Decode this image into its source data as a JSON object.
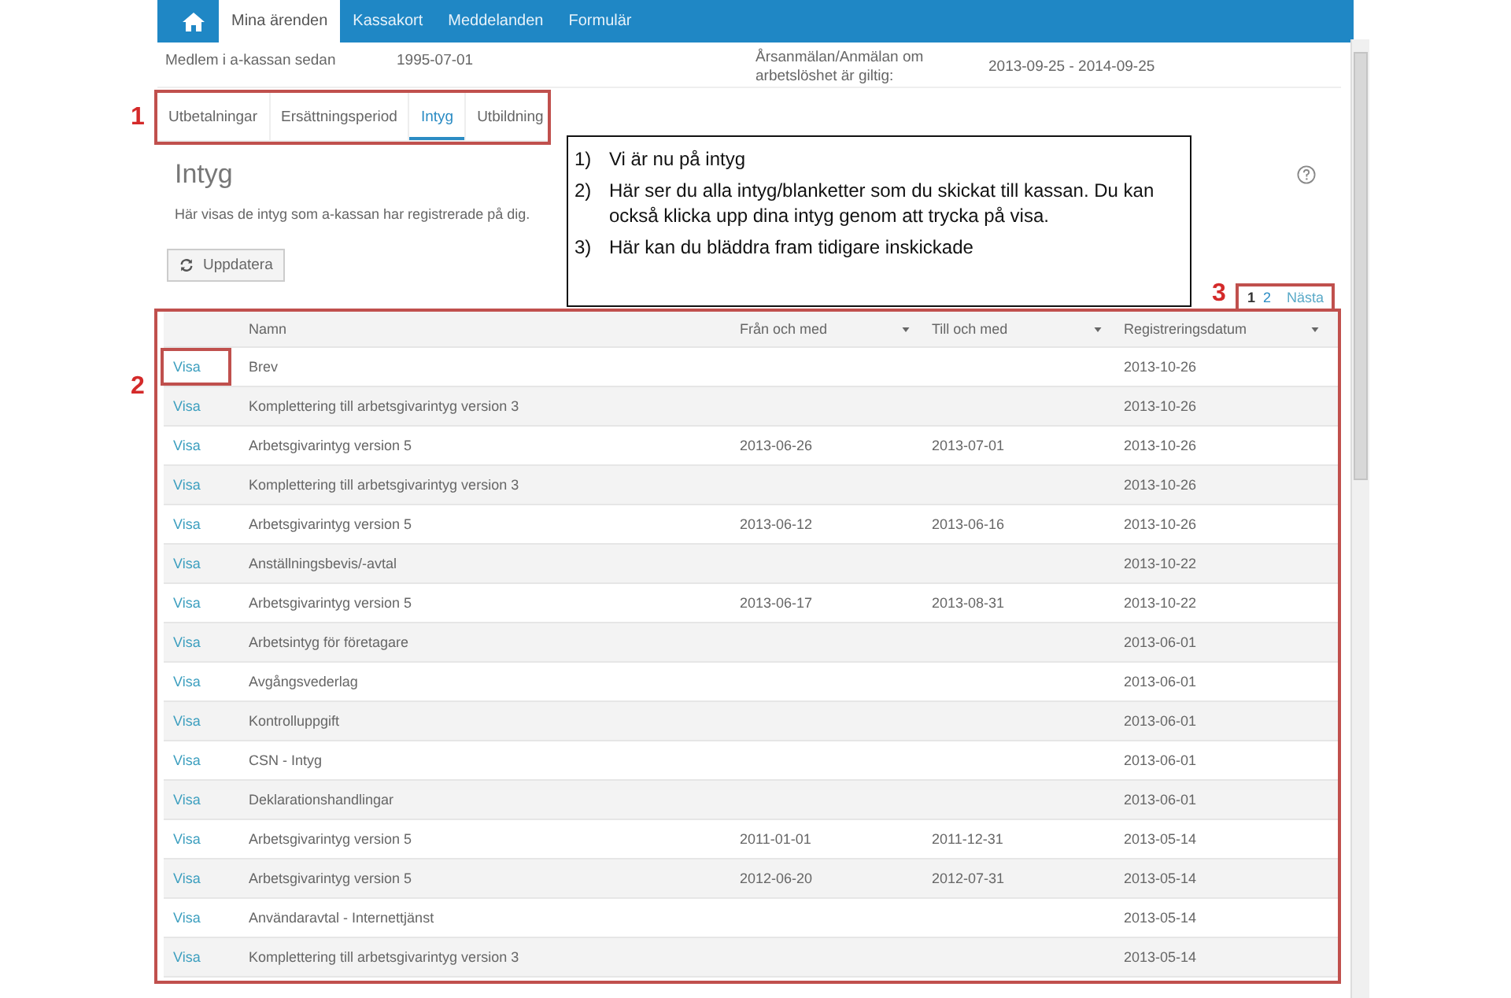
{
  "nav": {
    "items": [
      {
        "label": "Mina ärenden",
        "selected": true
      },
      {
        "label": "Kassakort",
        "selected": false
      },
      {
        "label": "Meddelanden",
        "selected": false
      },
      {
        "label": "Formulär",
        "selected": false
      }
    ]
  },
  "info": [
    {
      "label": "Medlem i a-kassan sedan",
      "value": "1995-07-01"
    },
    {
      "label": "Årsanmälan/Anmälan om arbetslöshet är giltig:",
      "value": "2013-09-25 - 2014-09-25"
    }
  ],
  "subtabs": {
    "highlighted": true,
    "items": [
      {
        "label": "Utbetalningar",
        "selected": false
      },
      {
        "label": "Ersättningsperiod",
        "selected": false
      },
      {
        "label": "Intyg",
        "selected": true
      },
      {
        "label": "Utbildning",
        "selected": false
      }
    ]
  },
  "heading": "Intyg",
  "description": "Här visas de intyg som a-kassan har registrerade på dig.",
  "refresh_button": "Uppdatera",
  "pagination": {
    "highlighted": true,
    "pages": [
      {
        "label": "1",
        "selected": true
      },
      {
        "label": "2",
        "selected": false
      }
    ],
    "next": "Nästa"
  },
  "table": {
    "highlighted": true,
    "columns": [
      {
        "label": "Namn",
        "sortable": false
      },
      {
        "label": "Från och med",
        "sortable": true
      },
      {
        "label": "Till och med",
        "sortable": true
      },
      {
        "label": "Registreringsdatum",
        "sortable": true
      }
    ],
    "rows": [
      {
        "link": "Visa",
        "highlighted": true,
        "name": "Brev",
        "from": "",
        "to": "",
        "registered": "2013-10-26"
      },
      {
        "link": "Visa",
        "highlighted": false,
        "name": "Komplettering till arbetsgivarintyg version 3",
        "from": "",
        "to": "",
        "registered": "2013-10-26"
      },
      {
        "link": "Visa",
        "highlighted": false,
        "name": "Arbetsgivarintyg version 5",
        "from": "2013-06-26",
        "to": "2013-07-01",
        "registered": "2013-10-26"
      },
      {
        "link": "Visa",
        "highlighted": false,
        "name": "Komplettering till arbetsgivarintyg version 3",
        "from": "",
        "to": "",
        "registered": "2013-10-26"
      },
      {
        "link": "Visa",
        "highlighted": false,
        "name": "Arbetsgivarintyg version 5",
        "from": "2013-06-12",
        "to": "2013-06-16",
        "registered": "2013-10-26"
      },
      {
        "link": "Visa",
        "highlighted": false,
        "name": "Anställningsbevis/-avtal",
        "from": "",
        "to": "",
        "registered": "2013-10-22"
      },
      {
        "link": "Visa",
        "highlighted": false,
        "name": "Arbetsgivarintyg version 5",
        "from": "2013-06-17",
        "to": "2013-08-31",
        "registered": "2013-10-22"
      },
      {
        "link": "Visa",
        "highlighted": false,
        "name": "Arbetsintyg för företagare",
        "from": "",
        "to": "",
        "registered": "2013-06-01"
      },
      {
        "link": "Visa",
        "highlighted": false,
        "name": "Avgångsvederlag",
        "from": "",
        "to": "",
        "registered": "2013-06-01"
      },
      {
        "link": "Visa",
        "highlighted": false,
        "name": "Kontrolluppgift",
        "from": "",
        "to": "",
        "registered": "2013-06-01"
      },
      {
        "link": "Visa",
        "highlighted": false,
        "name": "CSN - Intyg",
        "from": "",
        "to": "",
        "registered": "2013-06-01"
      },
      {
        "link": "Visa",
        "highlighted": false,
        "name": "Deklarationshandlingar",
        "from": "",
        "to": "",
        "registered": "2013-06-01"
      },
      {
        "link": "Visa",
        "highlighted": false,
        "name": "Arbetsgivarintyg version 5",
        "from": "2011-01-01",
        "to": "2011-12-31",
        "registered": "2013-05-14"
      },
      {
        "link": "Visa",
        "highlighted": false,
        "name": "Arbetsgivarintyg version 5",
        "from": "2012-06-20",
        "to": "2012-07-31",
        "registered": "2013-05-14"
      },
      {
        "link": "Visa",
        "highlighted": false,
        "name": "Användaravtal - Internettjänst",
        "from": "",
        "to": "",
        "registered": "2013-05-14"
      },
      {
        "link": "Visa",
        "highlighted": false,
        "name": "Komplettering till arbetsgivarintyg version 3",
        "from": "",
        "to": "",
        "registered": "2013-05-14"
      }
    ]
  },
  "callout": {
    "items": [
      {
        "number": "1)",
        "text": "Vi är nu på intyg"
      },
      {
        "number": "2)",
        "text": "Här ser du alla intyg/blanketter som du skickat till kassan. Du kan också klicka upp dina intyg genom att trycka på visa."
      },
      {
        "number": "3)",
        "text": "Här kan du bläddra fram tidigare inskickade"
      }
    ]
  },
  "markers": [
    {
      "label": "1",
      "kind": "subtabs"
    },
    {
      "label": "2",
      "kind": "row"
    },
    {
      "label": "3",
      "kind": "pagination"
    }
  ]
}
